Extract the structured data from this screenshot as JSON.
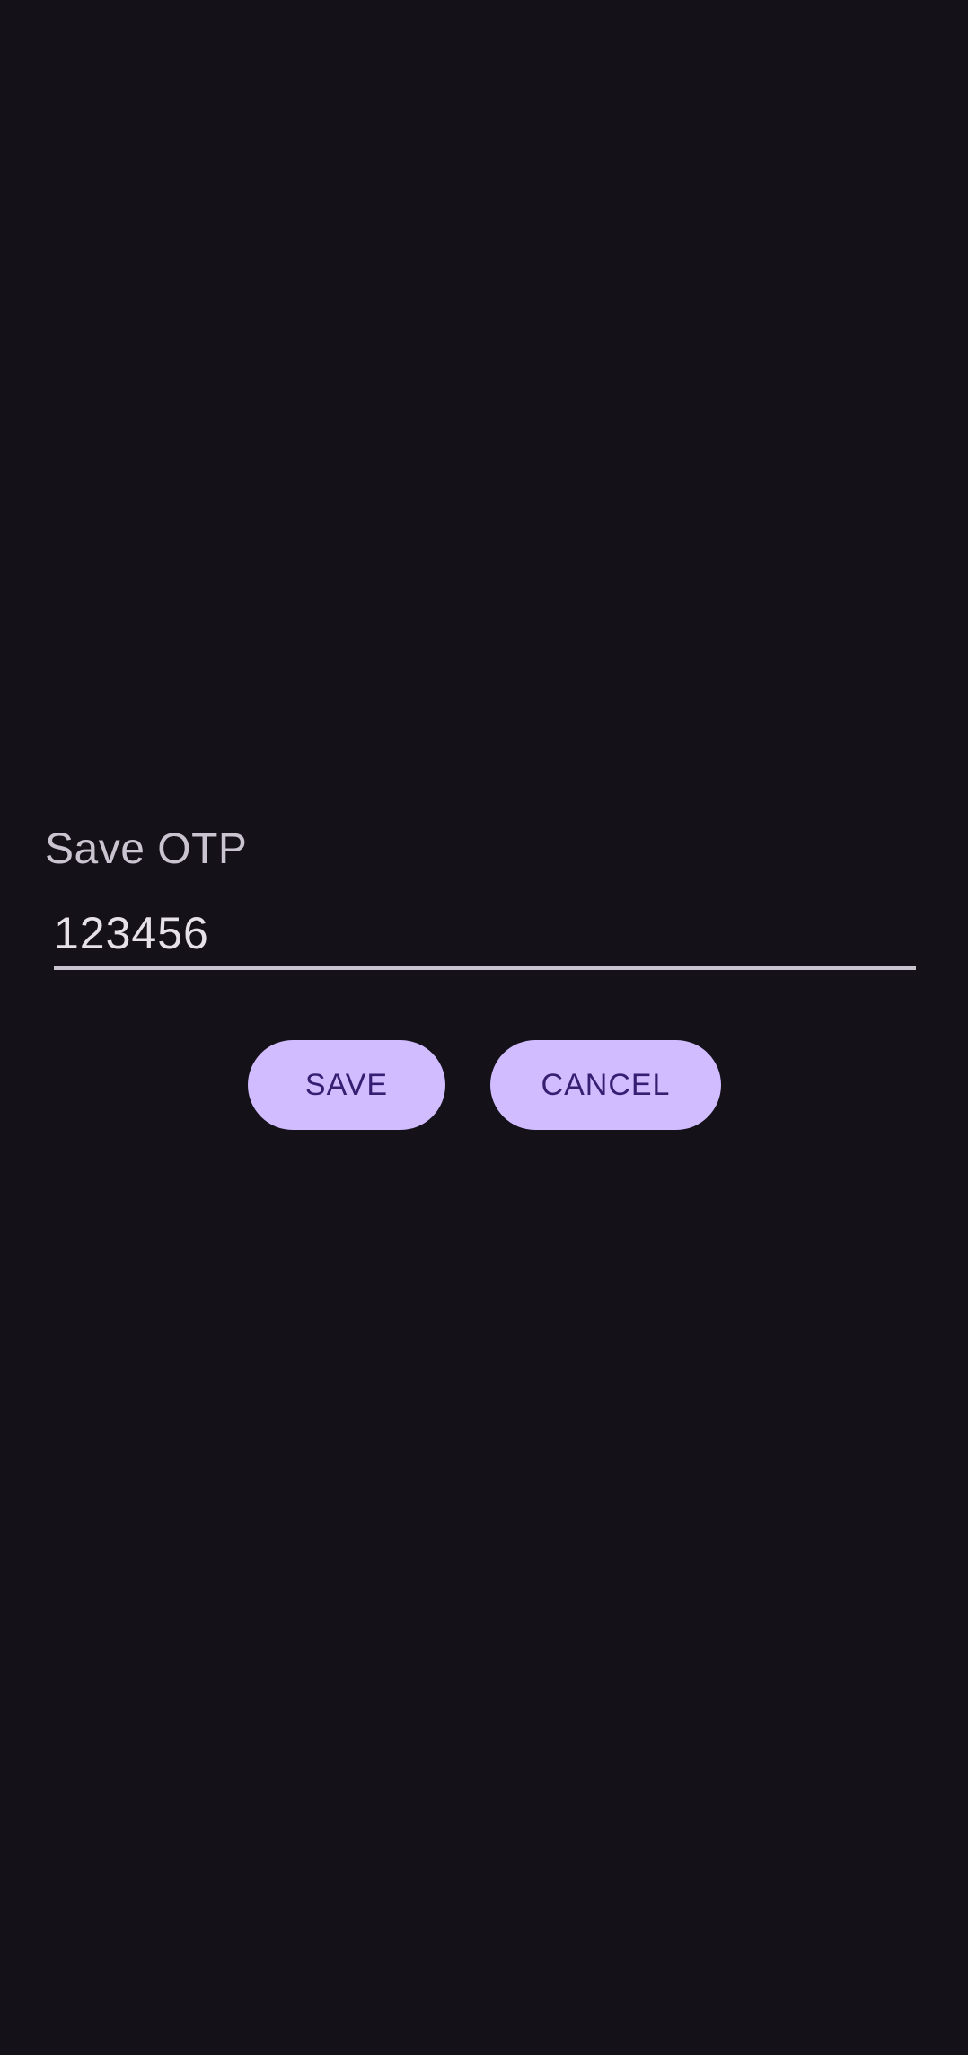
{
  "dialog": {
    "title": "Save OTP",
    "otp_value": "123456",
    "save_label": "SAVE",
    "cancel_label": "CANCEL"
  },
  "colors": {
    "background": "#141218",
    "title_text": "#cac4d0",
    "input_text": "#e6e0e9",
    "underline": "#cac4d0",
    "button_bg": "#d0bcff",
    "button_text": "#381e72"
  }
}
